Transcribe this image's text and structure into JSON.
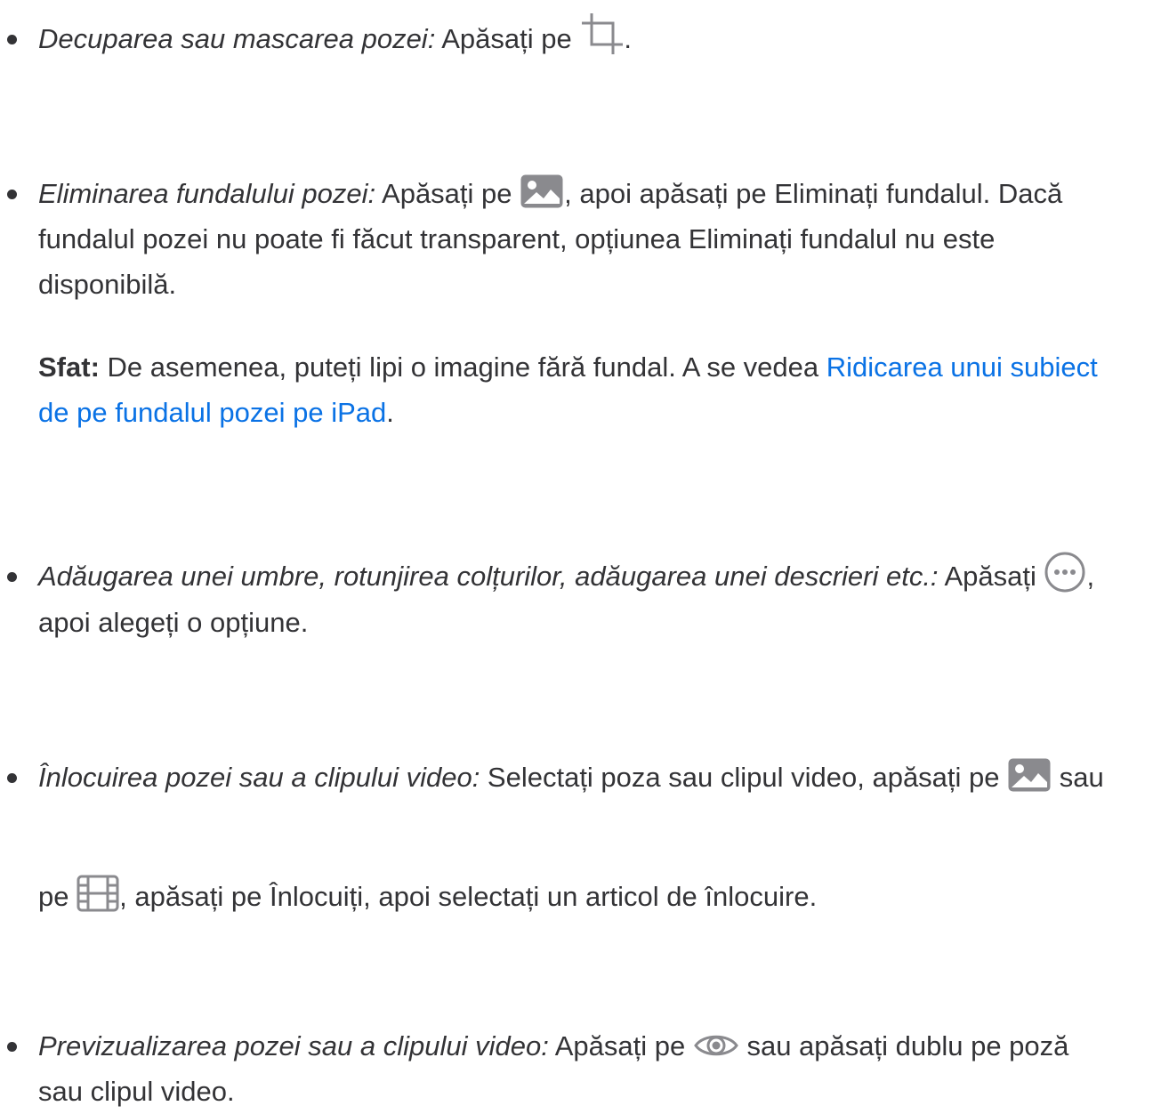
{
  "items": [
    {
      "lead": "Decuparea sau mascarea pozei:",
      "text_1": " Apăsați pe ",
      "icon_1": "crop-icon",
      "text_2": "."
    },
    {
      "lead": "Eliminarea fundalului pozei:",
      "text_1": " Apăsați pe ",
      "icon_1": "photo-icon",
      "line_1_rest": ", apoi apăsați pe Eliminați fundalul. Dacă",
      "line_2": "fundalul pozei nu poate fi făcut transparent, opțiunea Eliminați fundalul nu este",
      "line_3": "disponibilă."
    },
    {
      "lead": "Adăugarea unei umbre, rotunjirea colțurilor, adăugarea unei descrieri etc.:",
      "text_1": " Apăsați ",
      "icon_1": "more-icon",
      "text_2": ",",
      "line_2": "apoi alegeți o opțiune."
    },
    {
      "lead": "Înlocuirea pozei sau a clipului video:",
      "text_1": " Selectați poza sau clipul video, apăsați pe ",
      "icon_1": "photo-icon",
      "text_2": " sau",
      "line_2_a": "pe ",
      "icon_2": "film-icon",
      "line_2_b": ", apăsați pe Înlocuiți, apoi selectați un articol de înlocuire."
    },
    {
      "lead": "Previzualizarea pozei sau a clipului video:",
      "text_1": " Apăsați pe ",
      "icon_1": "eye-icon",
      "text_2": " sau apăsați dublu pe poză",
      "line_2": "sau clipul video."
    }
  ],
  "tip": {
    "label": "Sfat:",
    "text": " De asemenea, puteți lipi o imagine fără fundal. A se vedea ",
    "link_line_1": "Ridicarea unui subiect",
    "link_line_2": "de pe fundalul pozei pe iPad",
    "after": "."
  },
  "colors": {
    "text": "#333336",
    "link": "#0a72e5",
    "icon": "#8a8a8e"
  }
}
